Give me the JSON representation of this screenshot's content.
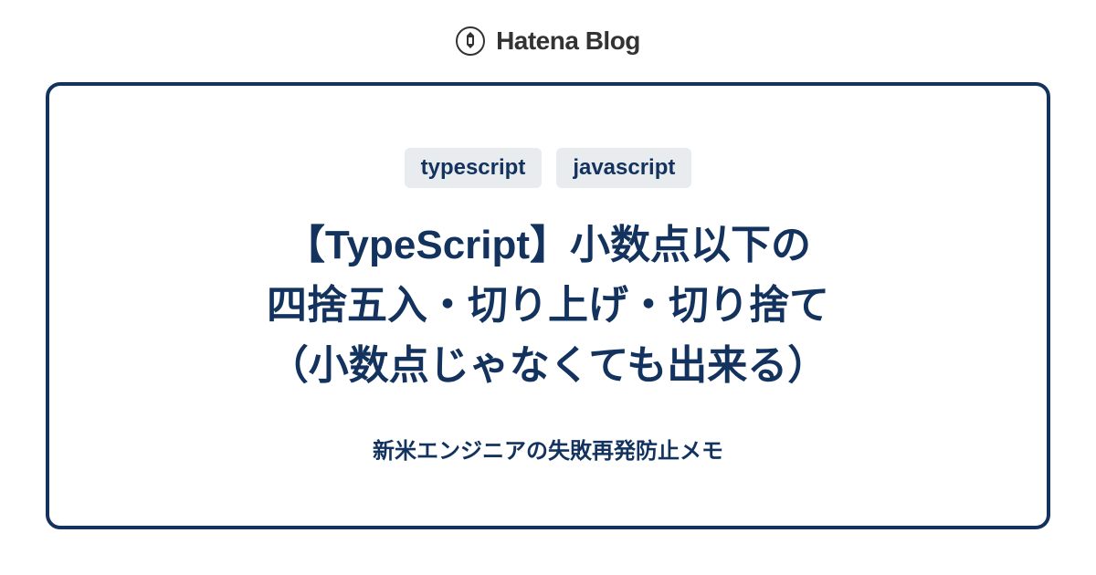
{
  "header": {
    "brand": "Hatena Blog"
  },
  "card": {
    "tags": [
      "typescript",
      "javascript"
    ],
    "title_line1": "【TypeScript】小数点以下の",
    "title_line2": "四捨五入・切り上げ・切り捨て",
    "title_line3": "（小数点じゃなくても出来る）",
    "subtitle": "新米エンジニアの失敗再発防止メモ"
  }
}
